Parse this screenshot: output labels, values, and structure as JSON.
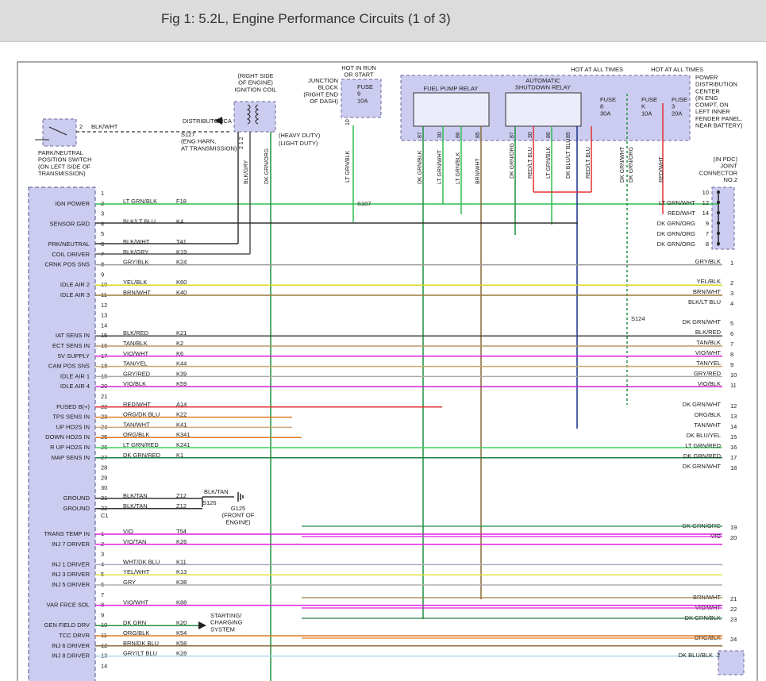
{
  "title": "Fig 1: 5.2L, Engine Performance Circuits (1 of 3)",
  "colors": {
    "pcm_box": "#ccccf0",
    "relay_box": "#d0d0f2",
    "wire_black": "#333333"
  },
  "c1_pins": [
    {
      "n": "1",
      "func": "",
      "color": "",
      "circuit": ""
    },
    {
      "n": "2",
      "func": "IGN POWER",
      "color": "LT GRN/BLK",
      "circuit": "F18"
    },
    {
      "n": "3",
      "func": "",
      "color": "",
      "circuit": ""
    },
    {
      "n": "4",
      "func": "SENSOR GRD",
      "color": "BLK/LT BLU",
      "circuit": "K4"
    },
    {
      "n": "5",
      "func": "",
      "color": "",
      "circuit": ""
    },
    {
      "n": "6",
      "func": "PRK/NEUTRAL",
      "color": "BLK/WHT",
      "circuit": "T41"
    },
    {
      "n": "7",
      "func": "COIL DRIVER",
      "color": "BLK/GRY",
      "circuit": "K19"
    },
    {
      "n": "8",
      "func": "CRNK POS SNS",
      "color": "GRY/BLK",
      "circuit": "K24"
    },
    {
      "n": "9",
      "func": "",
      "color": "",
      "circuit": ""
    },
    {
      "n": "10",
      "func": "IDLE AIR 2",
      "color": "YEL/BLK",
      "circuit": "K60"
    },
    {
      "n": "11",
      "func": "IDLE AIR 3",
      "color": "BRN/WHT",
      "circuit": "K40"
    },
    {
      "n": "12",
      "func": "",
      "color": "",
      "circuit": ""
    },
    {
      "n": "13",
      "func": "",
      "color": "",
      "circuit": ""
    },
    {
      "n": "14",
      "func": "",
      "color": "",
      "circuit": ""
    },
    {
      "n": "15",
      "func": "IAT SENS IN",
      "color": "BLK/RED",
      "circuit": "K21"
    },
    {
      "n": "16",
      "func": "ECT SENS IN",
      "color": "TAN/BLK",
      "circuit": "K2"
    },
    {
      "n": "17",
      "func": "5V SUPPLY",
      "color": "VIO/WHT",
      "circuit": "K6"
    },
    {
      "n": "18",
      "func": "CAM POS SNS",
      "color": "TAN/YEL",
      "circuit": "K44"
    },
    {
      "n": "19",
      "func": "IDLE AIR 1",
      "color": "GRY/RED",
      "circuit": "K39"
    },
    {
      "n": "20",
      "func": "IDLE AIR 4",
      "color": "VIO/BLK",
      "circuit": "K59"
    },
    {
      "n": "21",
      "func": "",
      "color": "",
      "circuit": ""
    },
    {
      "n": "22",
      "func": "FUSED B(+)",
      "color": "RED/WHT",
      "circuit": "A14"
    },
    {
      "n": "23",
      "func": "TPS SENS IN",
      "color": "ORG/DK BLU",
      "circuit": "K22"
    },
    {
      "n": "24",
      "func": "UP HO2S IN",
      "color": "TAN/WHT",
      "circuit": "K41"
    },
    {
      "n": "25",
      "func": "DOWN HO2S IN",
      "color": "ORG/BLK",
      "circuit": "K341"
    },
    {
      "n": "26",
      "func": "R UP HO2S IN",
      "color": "LT GRN/RED",
      "circuit": "K241"
    },
    {
      "n": "27",
      "func": "MAP SENS IN",
      "color": "DK GRN/RED",
      "circuit": "K1"
    },
    {
      "n": "28",
      "func": "",
      "color": "",
      "circuit": ""
    },
    {
      "n": "29",
      "func": "",
      "color": "",
      "circuit": ""
    },
    {
      "n": "30",
      "func": "",
      "color": "",
      "circuit": ""
    },
    {
      "n": "31",
      "func": "GROUND",
      "color": "BLK/TAN",
      "circuit": "Z12"
    },
    {
      "n": "32",
      "func": "GROUND",
      "color": "BLK/TAN",
      "circuit": "Z12"
    }
  ],
  "c1_label": "C1",
  "c2_pins": [
    {
      "n": "1",
      "func": "TRANS TEMP IN",
      "color": "VIO",
      "circuit": "T54"
    },
    {
      "n": "2",
      "func": "INJ 7 DRIVER",
      "color": "VIO/TAN",
      "circuit": "K26"
    },
    {
      "n": "3",
      "func": "",
      "color": "",
      "circuit": ""
    },
    {
      "n": "4",
      "func": "INJ 1 DRIVER",
      "color": "WHT/DK BLU",
      "circuit": "K11"
    },
    {
      "n": "5",
      "func": "INJ 3 DRIVER",
      "color": "YEL/WHT",
      "circuit": "K13"
    },
    {
      "n": "6",
      "func": "INJ 5 DRIVER",
      "color": "GRY",
      "circuit": "K38"
    },
    {
      "n": "7",
      "func": "",
      "color": "",
      "circuit": ""
    },
    {
      "n": "8",
      "func": "VAR FRCE SOL",
      "color": "VIO/WHT",
      "circuit": "K88"
    },
    {
      "n": "9",
      "func": "",
      "color": "",
      "circuit": ""
    },
    {
      "n": "10",
      "func": "GEN FIELD DRV",
      "color": "DK GRN",
      "circuit": "K20"
    },
    {
      "n": "11",
      "func": "TCC DRVR",
      "color": "ORG/BLK",
      "circuit": "K54"
    },
    {
      "n": "12",
      "func": "INJ 6 DRIVER",
      "color": "BRN/DK BLU",
      "circuit": "K58"
    },
    {
      "n": "13",
      "func": "INJ 8 DRIVER",
      "color": "GRY/LT BLU",
      "circuit": "K28"
    },
    {
      "n": "14",
      "func": "",
      "color": "",
      "circuit": ""
    }
  ],
  "right_lines_a": [
    {
      "n": "1",
      "color": "GRY/BLK"
    },
    {
      "n": "2",
      "color": "YEL/BLK"
    },
    {
      "n": "3",
      "color": "BRN/WHT"
    },
    {
      "n": "4",
      "color": "BLK/LT BLU"
    },
    {
      "n": "5",
      "color": "DK GRN/WHT"
    },
    {
      "n": "6",
      "color": "BLK/RED"
    },
    {
      "n": "7",
      "color": "TAN/BLK"
    },
    {
      "n": "8",
      "color": "VIO/WHT"
    },
    {
      "n": "9",
      "color": "TAN/YEL"
    },
    {
      "n": "10",
      "color": "GRY/RED"
    },
    {
      "n": "11",
      "color": "VIO/BLK"
    },
    {
      "n": "12",
      "color": "DK GRN/WHT"
    },
    {
      "n": "13",
      "color": "ORG/BLK"
    },
    {
      "n": "14",
      "color": "TAN/WHT"
    },
    {
      "n": "15",
      "color": "DK BLU/YEL"
    },
    {
      "n": "16",
      "color": "LT GRN/RED"
    },
    {
      "n": "17",
      "color": "DK GRN/RED"
    },
    {
      "n": "18",
      "color": "DK GRN/WHT"
    }
  ],
  "right_lines_b": [
    {
      "n": "19",
      "color": "DK GRN/ORG"
    },
    {
      "n": "20",
      "color": "VIO"
    },
    {
      "n": "21",
      "color": "BRN/WHT"
    },
    {
      "n": "22",
      "color": "VIO/WHT"
    },
    {
      "n": "23",
      "color": "DK GRN/BLK"
    },
    {
      "n": "24",
      "color": "ORG/BLK"
    }
  ],
  "joint_connector": {
    "label": "(IN PDC)\nJOINT\nCONNECTOR\nNO.2",
    "pins": [
      {
        "n": "10",
        "color": ""
      },
      {
        "n": "12",
        "color": "LT GRN/WHT"
      },
      {
        "n": "14",
        "color": "RED/WHT"
      },
      {
        "n": "9",
        "color": "DK GRN/ORG"
      },
      {
        "n": "7",
        "color": "DK GRN/ORG"
      },
      {
        "n": "8",
        "color": "DK GRN/ORG"
      }
    ]
  },
  "labels": {
    "hot_run_start": "HOT IN RUN\nOR START",
    "junction_block": "JUNCTION\nBLOCK\n(RIGHT END\nOF DASH)",
    "fuse9": "FUSE\n9\n10A",
    "jb_pin": "10",
    "hot_all_times_1": "HOT AT ALL TIMES",
    "hot_all_times_2": "HOT AT ALL TIMES",
    "pdc": "POWER\nDISTRIBUTION\nCENTER\n(IN ENG\nCOMPT, ON\nLEFT INNER\nFENDER PANEL,\nNEAR BATTERY)",
    "fuel_pump_relay": "FUEL PUMP RELAY",
    "asd_relay": "AUTOMATIC\nSHUTDOWN RELAY",
    "fuse8": "FUSE\n8\n30A",
    "fuseK": "FUSE\nK\n10A",
    "fuse3": "FUSE\n3\n20A",
    "coil_loc": "(RIGHT SIDE\nOF ENGINE)\nIGNITION COIL",
    "distributor": "DISTRIBUTOR",
    "nca": "NCA",
    "switch": "PARK/NEUTRAL\nPOSITION SWITCH\n(ON LEFT SIDE OF\nTRANSMISSION)",
    "switch_pin": "2",
    "switch_wire": "BLK/WHT",
    "s127": "S127\n(ENG HARN,\nAT TRANSMISSION)",
    "heavy": "(HEAVY DUTY)",
    "light": "(LIGHT DUTY)",
    "coil_pins": "2  1  2",
    "s107": "S107",
    "s124": "S124",
    "s126": "S126",
    "g125": "G125\n(FRONT OF\nENGINE)",
    "g_wire": "BLK/TAN",
    "starting": "STARTING/\nCHARGING\nSYSTEM",
    "dk_blu_blk": "DK BLU/BLK",
    "dk_blu_pin": "2",
    "wire_lt_grn_blk": "LT GRN/BLK",
    "wire_blk_gry": "BLK/GRY",
    "wire_dk_grn_org": "DK GRN/ORG",
    "relay_pins_fp": [
      "87",
      "30",
      "86",
      "85"
    ],
    "relay_pins_asd": [
      "87",
      "30",
      "86",
      "85"
    ],
    "relay_wires_fp": [
      "DK GRN/BLK",
      "LT GRN/WHT",
      "LT GRN/BLK",
      "BRN/WHT"
    ],
    "relay_wires_asd": [
      "DK GRN/ORG",
      "RED/LT BLU",
      "LT GRN/BLK",
      "DK BLU/LT BLU",
      "RED/LT BLU"
    ],
    "pdc_wires": [
      "DK GRN/WHT",
      "DK GRN/ORG",
      "RED/WHT"
    ]
  }
}
